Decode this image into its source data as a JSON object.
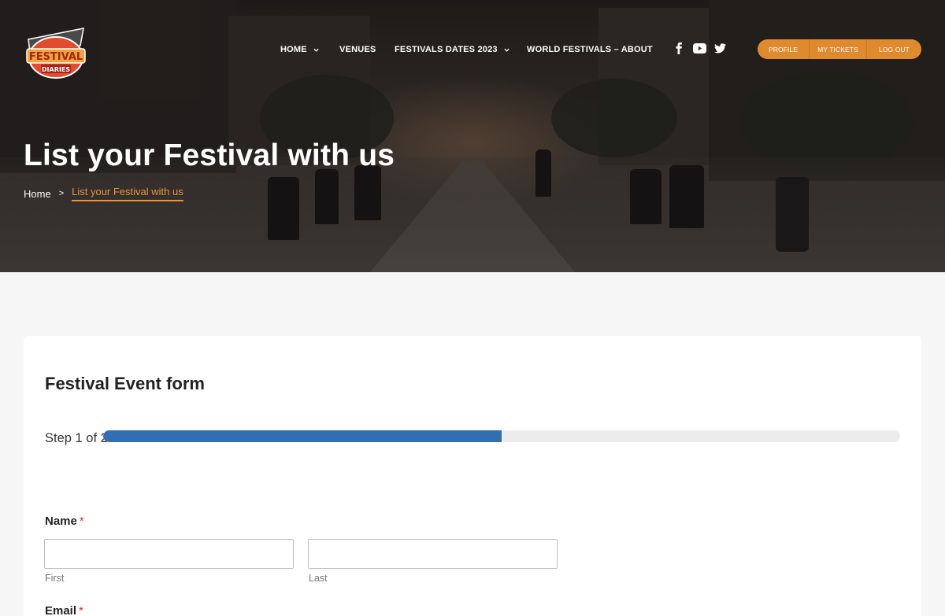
{
  "header": {
    "logo_alt": "Festival Diaries",
    "logo_line1": "FESTIVAL",
    "logo_line2": "DIARIES",
    "nav": [
      {
        "label": "HOME",
        "has_dropdown": true
      },
      {
        "label": "VENUES",
        "has_dropdown": false
      },
      {
        "label": "FESTIVALS DATES 2023",
        "has_dropdown": true
      },
      {
        "label": "WORLD FESTIVALS – ABOUT",
        "has_dropdown": false
      }
    ],
    "social": [
      "facebook-icon",
      "youtube-icon",
      "twitter-icon"
    ],
    "account": {
      "profile": "PROFILE",
      "tickets": "MY TICKETS",
      "logout": "LOG OUT"
    },
    "accent_color": "#e08a2e"
  },
  "hero": {
    "title": "List your Festival with us",
    "breadcrumb": {
      "home": "Home",
      "separator": ">",
      "current": "List your Festival with us"
    }
  },
  "form": {
    "title": "Festival Event form",
    "step_text": "Step 1 of 2",
    "progress_fraction": 0.5,
    "progress_color": "#336db2",
    "name_label": "Name",
    "required_mark": "*",
    "first_sublabel": "First",
    "last_sublabel": "Last",
    "first_value": "",
    "last_value": "",
    "email_label": "Email"
  }
}
